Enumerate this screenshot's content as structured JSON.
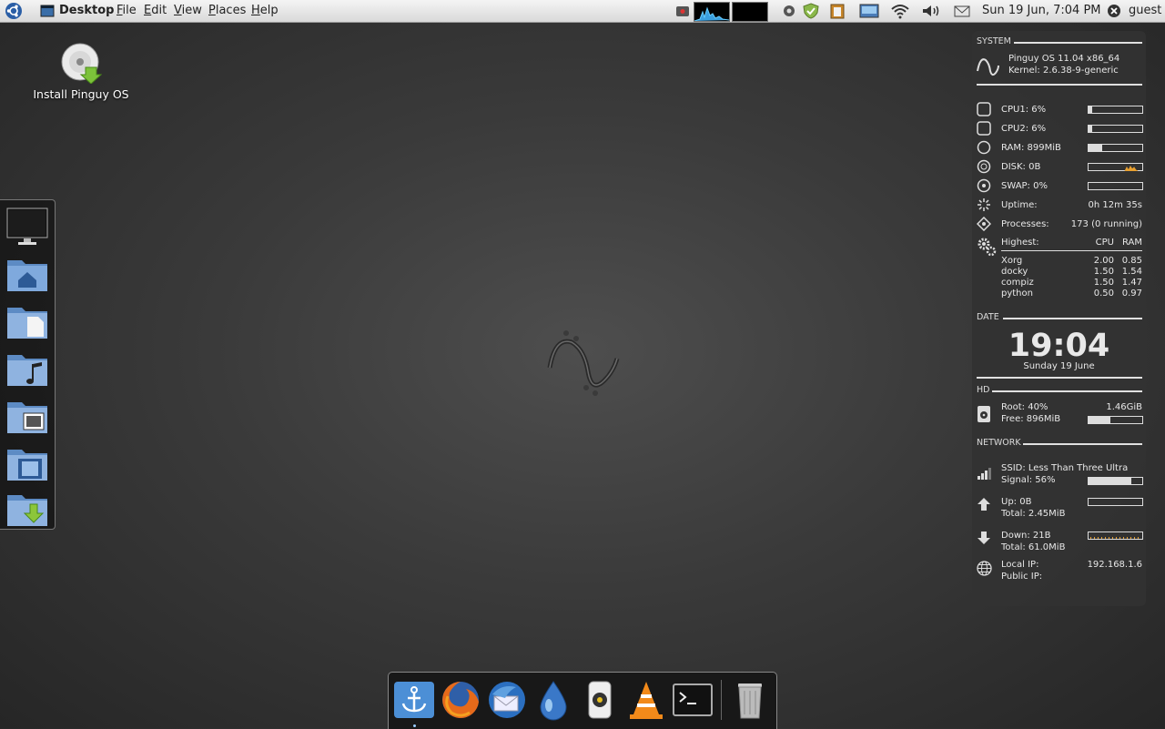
{
  "top_panel": {
    "desktop_label": "Desktop",
    "menus": [
      "File",
      "Edit",
      "View",
      "Places",
      "Help"
    ],
    "datetime": "Sun 19 Jun,  7:04 PM",
    "user": "guest"
  },
  "desktop_icons": [
    {
      "label": "Install Pinguy OS",
      "icon": "cd-install-icon"
    }
  ],
  "left_dock": [
    "monitor-icon",
    "home-folder-icon",
    "documents-folder-icon",
    "music-folder-icon",
    "pictures-folder-icon",
    "videos-folder-icon",
    "downloads-folder-icon"
  ],
  "bottom_dock": [
    "docky-anchor-icon",
    "firefox-icon",
    "thunderbird-icon",
    "deluge-icon",
    "rhythmbox-icon",
    "vlc-icon",
    "terminal-icon",
    "trash-icon"
  ],
  "conky": {
    "system": {
      "header": "SYSTEM",
      "os": "Pinguy OS 11.04 x86_64",
      "kernel": "Kernel: 2.6.38-9-generic",
      "cpu1": "CPU1: 6%",
      "cpu1_level": 0.06,
      "cpu2": "CPU2: 6%",
      "cpu2_level": 0.06,
      "ram": "RAM: 899MiB",
      "ram_level": 0.25,
      "disk": "DISK: 0B",
      "swap": "SWAP: 0%",
      "swap_level": 0.0,
      "uptime_label": "Uptime:",
      "uptime": "0h 12m 35s",
      "processes_label": "Processes:",
      "processes": "173 (0 running)",
      "highest_label": "Highest:",
      "cpu_col": "CPU",
      "ram_col": "RAM",
      "top": [
        {
          "name": "Xorg",
          "cpu": "2.00",
          "ram": "0.85"
        },
        {
          "name": "docky",
          "cpu": "1.50",
          "ram": "1.54"
        },
        {
          "name": "compiz",
          "cpu": "1.50",
          "ram": "1.47"
        },
        {
          "name": "python",
          "cpu": "0.50",
          "ram": "0.97"
        }
      ]
    },
    "date": {
      "header": "DATE",
      "time": "19:04",
      "day": "Sunday 19 June"
    },
    "hd": {
      "header": "HD",
      "root": "Root: 40%",
      "root_size": "1.46GiB",
      "free": "Free: 896MiB",
      "root_level": 0.4
    },
    "network": {
      "header": "NETWORK",
      "ssid": "SSID: Less Than Three Ultra",
      "signal": "Signal: 56%",
      "signal_level": 0.8,
      "up": "Up: 0B",
      "up_total": "Total: 2.45MiB",
      "down": "Down: 21B",
      "down_total": "Total: 61.0MiB",
      "local_ip_label": "Local IP:",
      "local_ip": "192.168.1.6",
      "public_ip_label": "Public IP:"
    }
  }
}
